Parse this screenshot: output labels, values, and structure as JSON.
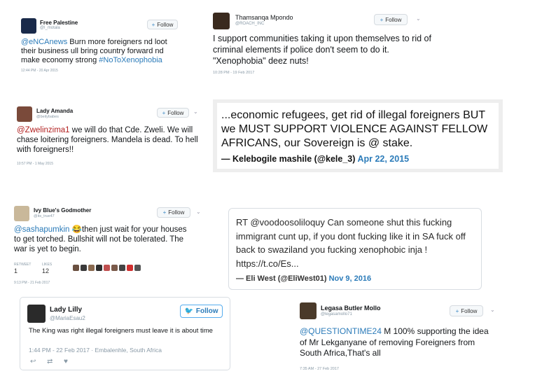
{
  "tweets": [
    {
      "name": "Free Palestine",
      "handle": "@l_motala",
      "follow": "Follow",
      "mention": "@eNCAnews",
      "text": " Burn more foreigners nd loot their business ull bring country forward nd make economy strong ",
      "hashtag": "#NoToXenophobia",
      "meta": "12:44 PM - 20 Apr 2015",
      "avatar_color": "#1a2a4a"
    },
    {
      "name": "Thamsanqa Mpondo",
      "handle": "@ROACH_INC",
      "follow": "Follow",
      "text": "I support communities taking it upon themselves to rid of criminal elements if police don't seem to do it. \"Xenophobia\" deez nuts!",
      "meta": "10:28 PM - 19 Feb 2017",
      "avatar_color": "#3a2a1e"
    },
    {
      "name": "Lady Amanda",
      "handle": "@beilybabes",
      "follow": "Follow",
      "mention": "@Zwelinzima1",
      "text": " we will do that Cde. Zweli. We will chase loitering foreigners. Mandela is dead. To hell with foreigners!!",
      "meta": "10:57 PM - 1 May 2015",
      "avatar_color": "#7a4a3a"
    },
    {
      "name": "Ivy Blue's Godmother",
      "handle": "@its_true47",
      "follow": "Follow",
      "mention": "@sashapumkin",
      "emoji": "😂",
      "text": "then just wait for your houses to get torched. Bullshit will not be tolerated. The war is yet to begin.",
      "retweets_label": "RETWEET",
      "retweets": "1",
      "likes_label": "LIKES",
      "likes": "12",
      "meta": "9:13 PM - 21 Feb 2017",
      "avatar_color": "#c9b89a"
    },
    {
      "name": "Legasa Butler Mollo",
      "handle": "@legasamollo71",
      "follow": "Follow",
      "mention": "@QUESTIONTIME24",
      "text": " M 100% supporting the idea of Mr Lekganyane of removing Foreigners from South Africa,That's all",
      "meta": "7:35 AM - 27 Feb 2017",
      "avatar_color": "#4a3a2a"
    }
  ],
  "quote": {
    "text": "...economic refugees, get rid of illegal foreigners BUT we MUST SUPPORT VIOLENCE AGAINST FELLOW AFRICANS, our Sovereign is @ stake.",
    "attribution": "— Kelebogile mashile (@kele_3)",
    "date": "Apr 22, 2015"
  },
  "embed": {
    "text": "RT @voodoosoliloquy Can someone shut this fucking immigrant cunt up, if you dont fucking like it in SA fuck off back to swaziland you fucking xenophobic inja ! https://t.co/Es...",
    "attribution": "— Eli West (@EliWest01)",
    "date": "Nov 9, 2016"
  },
  "lilly": {
    "name": "Lady Lilly",
    "handle": "@MariaEsau2",
    "follow": "Follow",
    "text": "The King was right illegal foreigners must leave it is about time",
    "meta": "1:44 PM - 22 Feb 2017 · Embalenhle, South Africa",
    "avatar_color": "#2a2a2a"
  },
  "colors": {
    "link": "#2b7bb9",
    "mention_red": "#b22222"
  },
  "icons": [
    "person-plus-icon",
    "chevron-down-icon",
    "twitter-bird-icon",
    "reply-icon",
    "retweet-icon",
    "heart-icon"
  ]
}
